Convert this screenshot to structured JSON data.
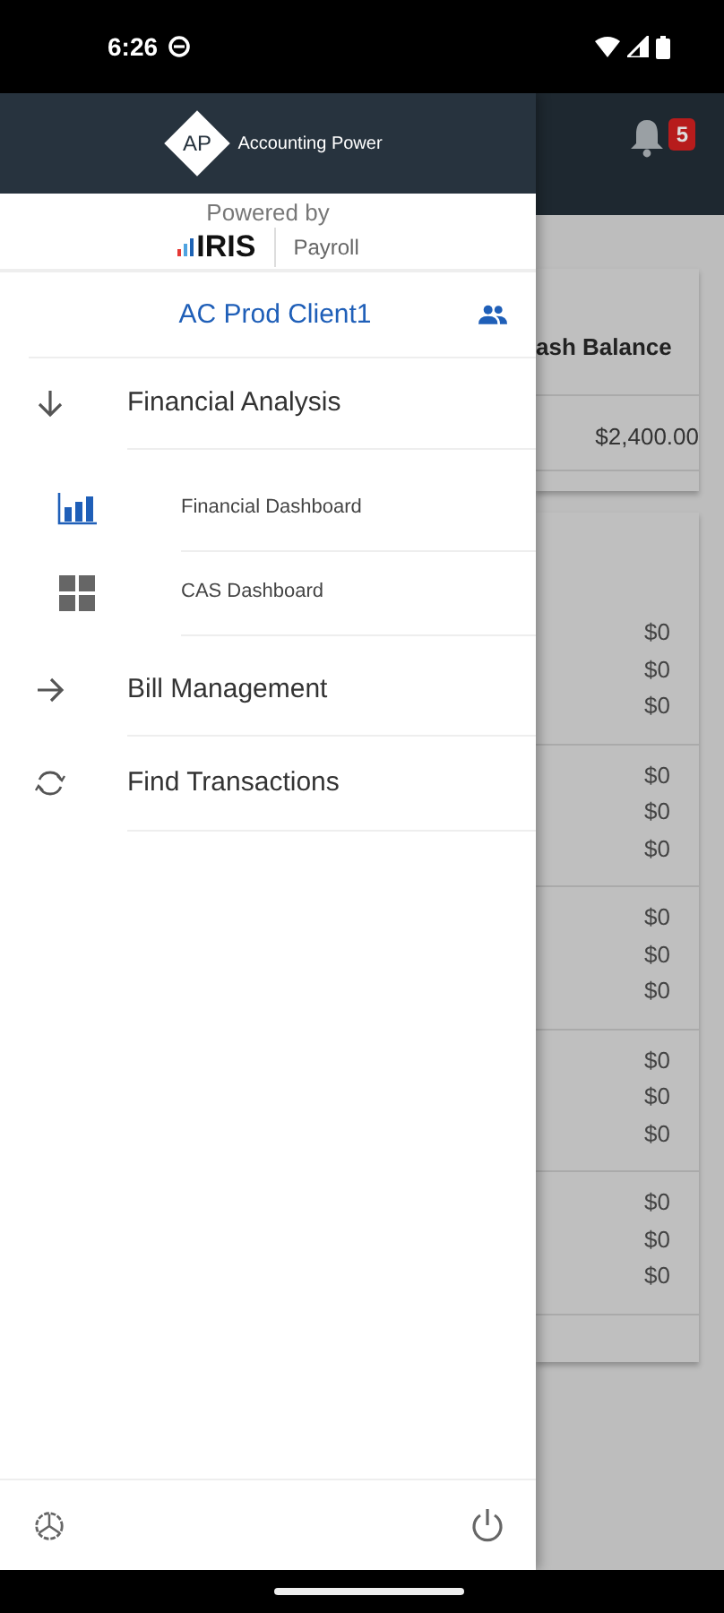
{
  "status_bar": {
    "time": "6:26"
  },
  "app_bar": {
    "notification_count": "5"
  },
  "drawer": {
    "brand_mark": "AP",
    "brand_name": "Accounting Power",
    "powered_by": "Powered by",
    "partner": "IRIS",
    "product": "Payroll",
    "client": "AC Prod Client1",
    "menu": [
      {
        "label": "Financial Analysis",
        "kind": "group",
        "expanded": true,
        "children": [
          {
            "label": "Financial Dashboard",
            "kind": "chart"
          },
          {
            "label": "CAS Dashboard",
            "kind": "grid"
          }
        ]
      },
      {
        "label": "Bill Management",
        "kind": "group",
        "expanded": false
      },
      {
        "label": "Find Transactions",
        "kind": "refresh"
      }
    ]
  },
  "background": {
    "column_heading": "ash Balance",
    "total": "$2,400.00",
    "groups": [
      [
        "$0",
        "$0",
        "$0"
      ],
      [
        "$0",
        "$0",
        "$0"
      ],
      [
        "$0",
        "$0",
        "$0"
      ],
      [
        "$0",
        "$0",
        "$0"
      ],
      [
        "$0",
        "$0",
        "$0"
      ]
    ]
  }
}
